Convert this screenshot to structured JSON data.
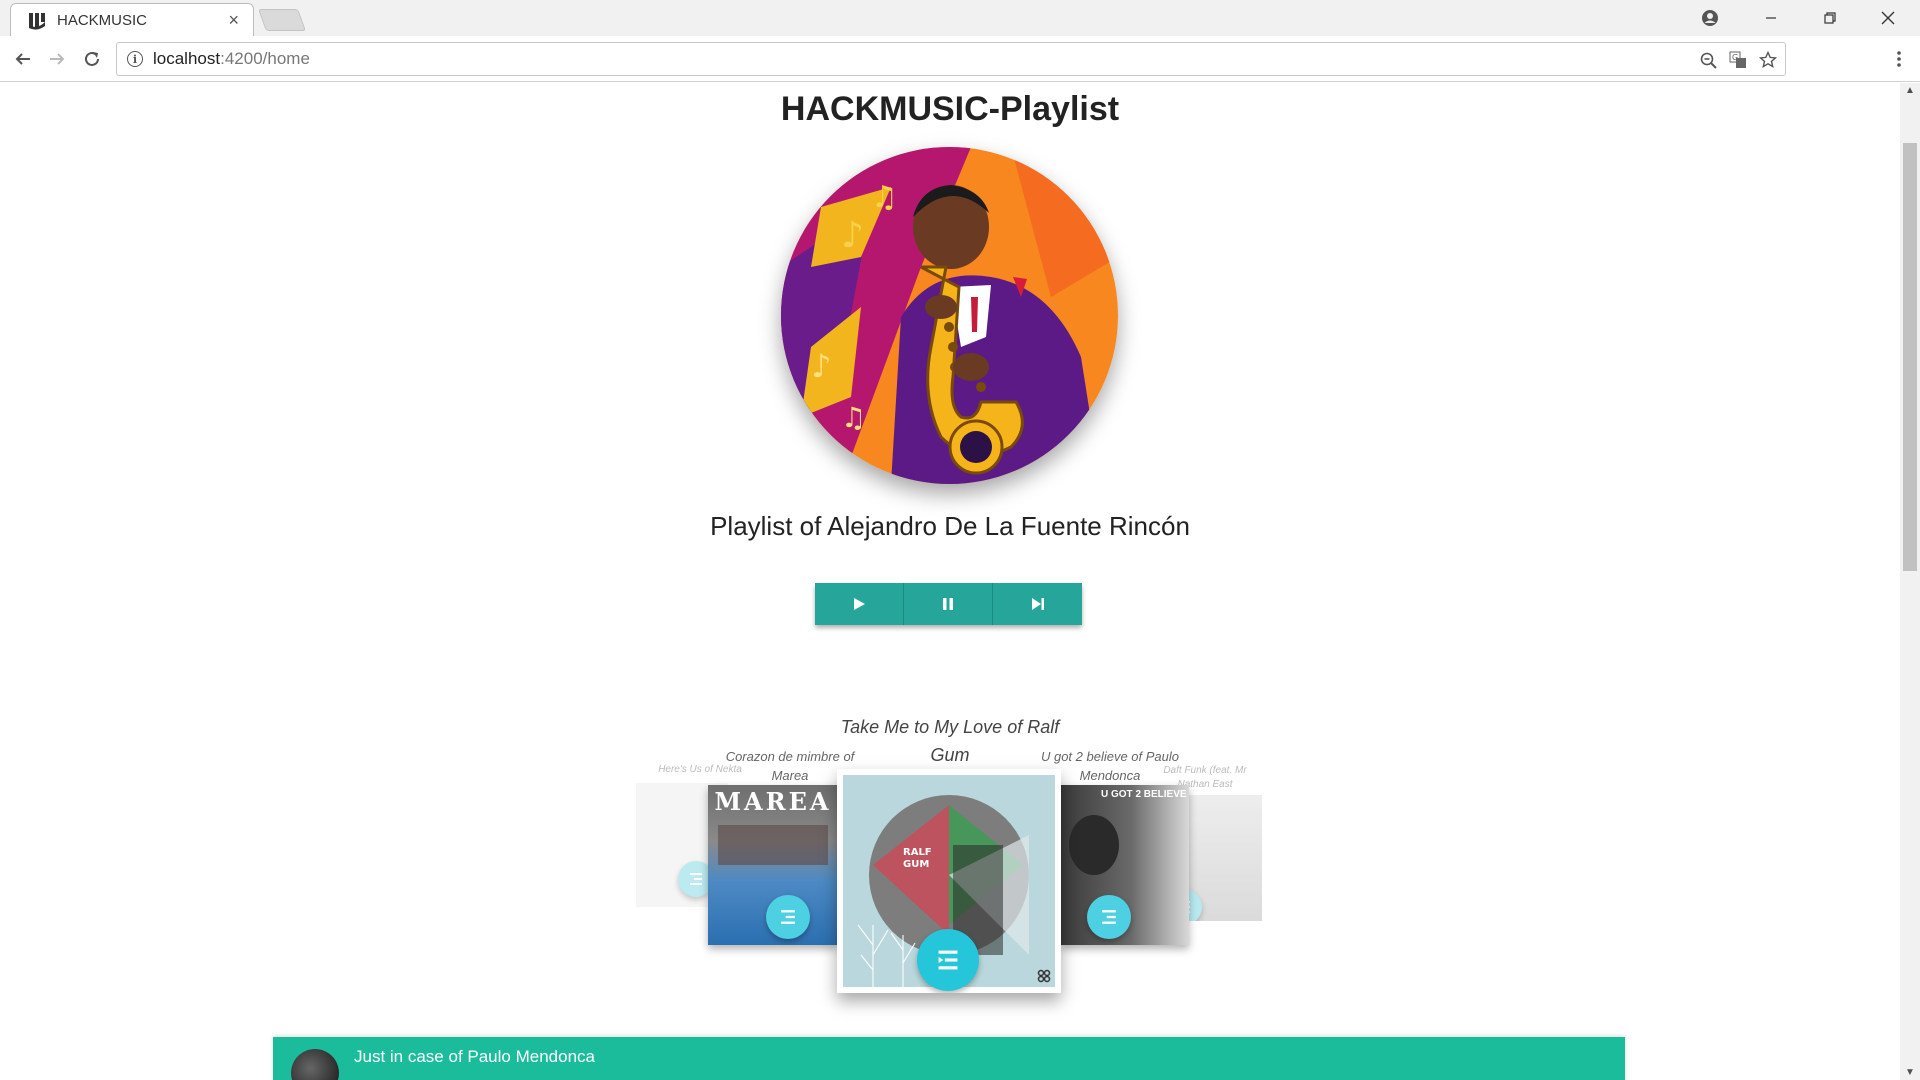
{
  "browser": {
    "tab_title": "HACKMUSIC",
    "tab_close": "×",
    "url_host": "localhost",
    "url_path": ":4200/home"
  },
  "page": {
    "title": "HACKMUSIC-Playlist",
    "owner": "Playlist of Alejandro De La Fuente Rincón"
  },
  "controls": [
    "play-icon",
    "pause-icon",
    "skip-next-icon"
  ],
  "carousel": {
    "current": {
      "label_line1": "Take Me to My Love of Ralf",
      "label_line2": "Gum",
      "cover_text": [
        "RALF",
        "GUM"
      ]
    },
    "left_near": {
      "label_line1": "Corazon de mimbre of",
      "label_line2": "Marea",
      "cover_text": "MAREA"
    },
    "left_far": {
      "label": "Here's Us of Nekta"
    },
    "right_near": {
      "label_line1": "U got 2 believe of Paulo",
      "label_line2": "Mendonca",
      "cover_text": "U GOT 2 BELIEVE"
    },
    "right_far": {
      "label_line1": "Daft Funk (feat. Mr",
      "label_line2": "Nathan East"
    }
  },
  "now_playing": {
    "text": "Just in case of Paulo Mendonca"
  },
  "colors": {
    "control_teal": "#26a69a",
    "fab_cyan": "#4dd0e1",
    "nowbar_green": "#1abc9c"
  }
}
